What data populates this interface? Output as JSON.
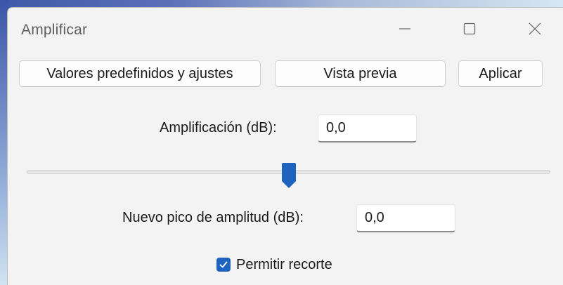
{
  "window": {
    "title": "Amplificar",
    "controls": {
      "minimize_icon": "minimize-icon",
      "maximize_icon": "maximize-icon",
      "close_icon": "close-icon"
    }
  },
  "toolbar": {
    "presets_label": "Valores predefinidos y ajustes",
    "preview_label": "Vista previa",
    "apply_label": "Aplicar"
  },
  "amplification": {
    "label": "Amplificación (dB):",
    "value": "0,0"
  },
  "slider": {
    "level_fraction": 0.5
  },
  "peak": {
    "label": "Nuevo pico de amplitud (dB):",
    "value": "0,0"
  },
  "clipping": {
    "label": "Permitir recorte",
    "checked": true
  },
  "colors": {
    "accent": "#1f63c1",
    "window_bg": "#f3f3f3"
  }
}
